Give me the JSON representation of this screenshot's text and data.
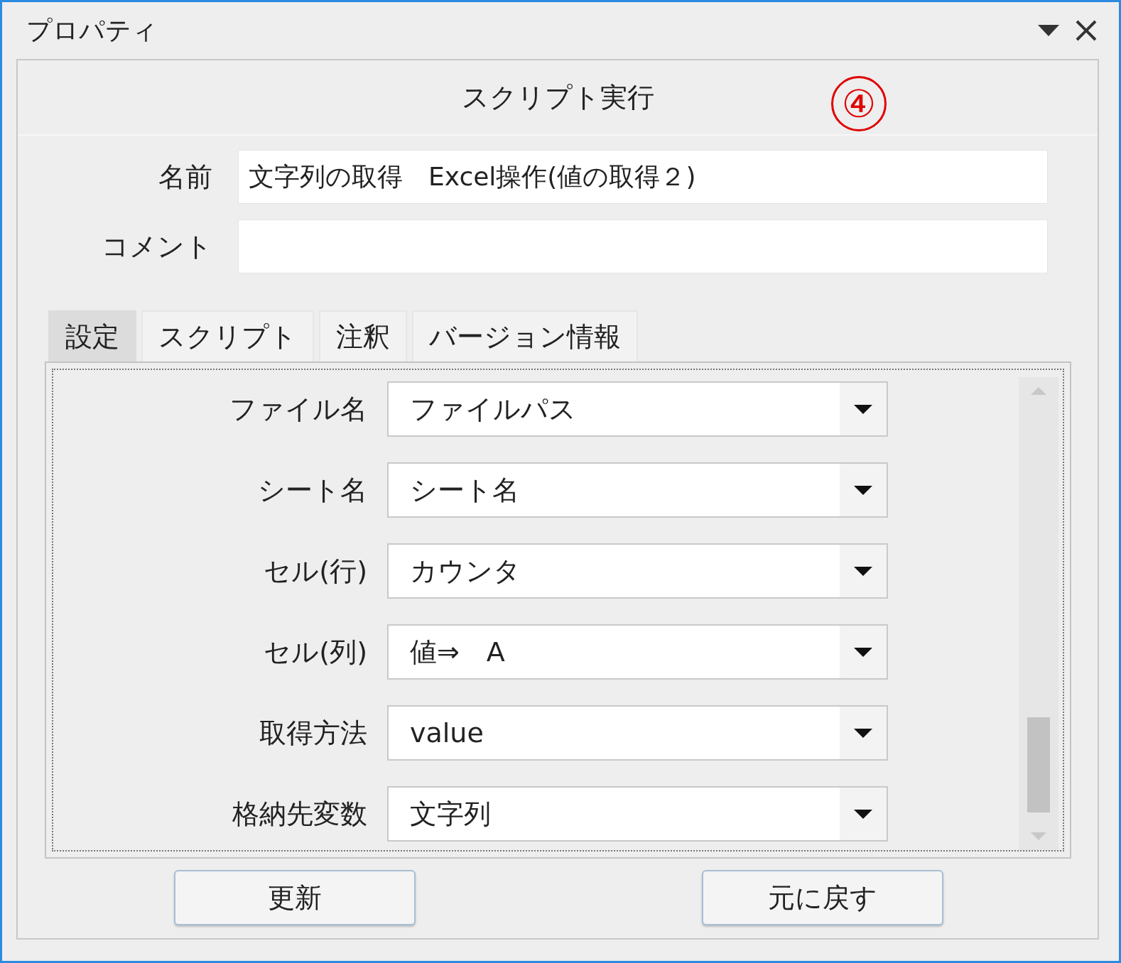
{
  "window": {
    "title": "プロパティ"
  },
  "header": {
    "title": "スクリプト実行",
    "annotation": "④"
  },
  "fields": [
    {
      "label": "名前",
      "value": "文字列の取得　Excel操作(値の取得２)"
    },
    {
      "label": "コメント"
    }
  ],
  "tabs": [
    {
      "label": "設定",
      "selected": true
    },
    {
      "label": "スクリプト",
      "selected": false
    },
    {
      "label": "注釈",
      "selected": false
    },
    {
      "label": "バージョン情報",
      "selected": false
    }
  ],
  "settings": [
    {
      "label": "ファイル名",
      "value": "ファイルパス"
    },
    {
      "label": "シート名",
      "value": "シート名"
    },
    {
      "label": "セル(行)",
      "value": "カウンタ"
    },
    {
      "label": "セル(列)",
      "value": "値⇒　A"
    },
    {
      "label": "取得方法",
      "value": "value"
    },
    {
      "label": "格納先変数",
      "value": "文字列"
    }
  ],
  "buttons": [
    "更新",
    "元に戻す"
  ]
}
